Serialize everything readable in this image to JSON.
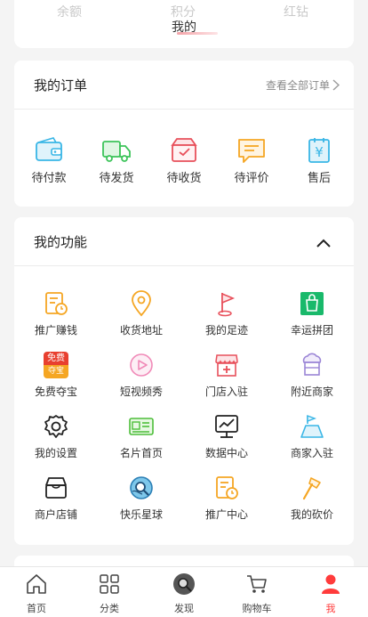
{
  "top": {
    "stats": [
      "余额",
      "积分",
      "红钻"
    ],
    "mine_label": "我的"
  },
  "orders": {
    "title": "我的订单",
    "view_all": "查看全部订单",
    "items": [
      {
        "label": "待付款",
        "icon": "wallet-icon"
      },
      {
        "label": "待发货",
        "icon": "truck-icon"
      },
      {
        "label": "待收货",
        "icon": "box-icon"
      },
      {
        "label": "待评价",
        "icon": "comment-icon"
      },
      {
        "label": "售后",
        "icon": "refund-icon"
      }
    ]
  },
  "functions": {
    "title": "我的功能",
    "items": [
      {
        "label": "推广赚钱",
        "icon": "promote-icon"
      },
      {
        "label": "收货地址",
        "icon": "location-icon"
      },
      {
        "label": "我的足迹",
        "icon": "flag-icon"
      },
      {
        "label": "幸运拼团",
        "icon": "group-buy-icon"
      },
      {
        "label": "免费夺宝",
        "icon": "free-treasure-icon",
        "badge_top": "免费",
        "badge_bottom": "夺宝"
      },
      {
        "label": "短视频秀",
        "icon": "video-icon"
      },
      {
        "label": "门店入驻",
        "icon": "store-icon"
      },
      {
        "label": "附近商家",
        "icon": "nearby-shop-icon"
      },
      {
        "label": "我的设置",
        "icon": "gear-icon"
      },
      {
        "label": "名片首页",
        "icon": "business-card-icon"
      },
      {
        "label": "数据中心",
        "icon": "data-icon"
      },
      {
        "label": "商家入驻",
        "icon": "merchant-icon"
      },
      {
        "label": "商户店铺",
        "icon": "shop-icon"
      },
      {
        "label": "快乐星球",
        "icon": "planet-icon"
      },
      {
        "label": "推广中心",
        "icon": "promote-center-icon"
      },
      {
        "label": "我的砍价",
        "icon": "axe-icon"
      }
    ]
  },
  "tabbar": {
    "items": [
      {
        "label": "首页",
        "icon": "home-icon"
      },
      {
        "label": "分类",
        "icon": "category-icon"
      },
      {
        "label": "发现",
        "icon": "discover-icon"
      },
      {
        "label": "购物车",
        "icon": "cart-icon"
      },
      {
        "label": "我",
        "icon": "user-icon"
      }
    ],
    "active_color": "#ff3b3b"
  },
  "colors": {
    "accent": "#ff3b3b",
    "orange": "#f5a623",
    "blue": "#39b6e6",
    "green": "#3cc45a"
  }
}
